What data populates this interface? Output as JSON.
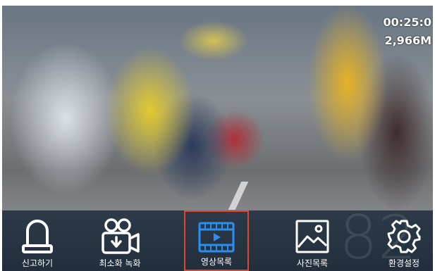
{
  "status": {
    "recording_time": "00:25:0",
    "storage": "2,966M"
  },
  "watermark": {
    "text": "82"
  },
  "menu": {
    "selected_color": "#e0452b",
    "icon_color": "#ffffff",
    "selected_icon_color": "#2a8ff0",
    "items": [
      {
        "label": "신고하기",
        "icon": "siren-icon"
      },
      {
        "label": "최소화 녹화",
        "icon": "video-camera-record-icon"
      },
      {
        "label": "영상목록",
        "icon": "film-strip-icon",
        "selected": true
      },
      {
        "label": "사진목록",
        "icon": "picture-icon"
      },
      {
        "label": "환경설정",
        "icon": "gear-icon"
      }
    ]
  }
}
